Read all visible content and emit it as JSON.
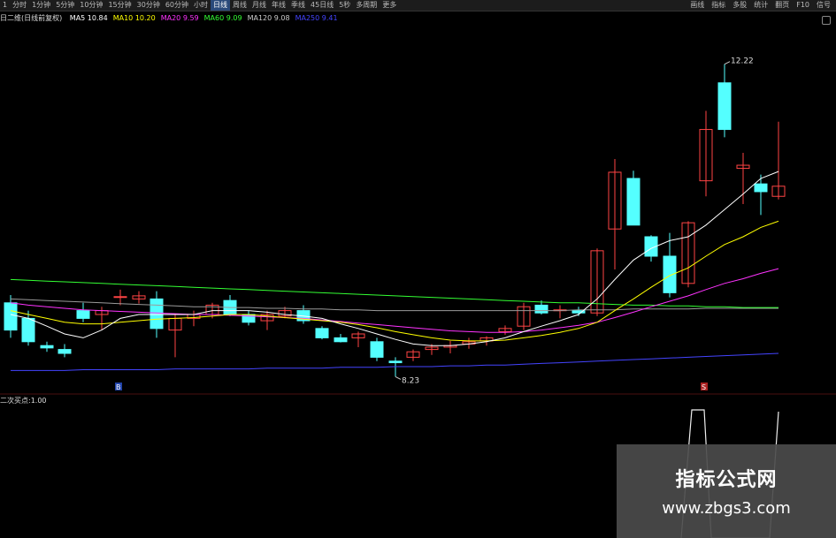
{
  "toolbar": {
    "left_items": [
      "1",
      "分时",
      "1分钟",
      "5分钟",
      "10分钟",
      "15分钟",
      "30分钟",
      "60分钟",
      "小时",
      "日线",
      "周线",
      "月线",
      "年线",
      "季线",
      "45日线",
      "5秒",
      "多周期",
      "更多"
    ],
    "active_index": 9,
    "right_items": [
      "画线",
      "指标",
      "多股",
      "统计",
      "翻页",
      "F10",
      "信号"
    ]
  },
  "legend": {
    "title": "日二维(日线前复权)",
    "items": [
      {
        "label": "MA5",
        "value": "10.84",
        "color": "#ffffff"
      },
      {
        "label": "MA10",
        "value": "10.20",
        "color": "#ffff00"
      },
      {
        "label": "MA20",
        "value": "9.59",
        "color": "#ff33ff"
      },
      {
        "label": "MA60",
        "value": "9.09",
        "color": "#33ff33"
      },
      {
        "label": "MA120",
        "value": "9.08",
        "color": "#cccccc"
      },
      {
        "label": "MA250",
        "value": "9.41",
        "color": "#4444ff"
      }
    ]
  },
  "annotations": {
    "high": "12.22",
    "low": "8.23"
  },
  "signal_labels": [
    "B",
    "S"
  ],
  "sub_indicator": {
    "label": "二次买点",
    "value": "1.00"
  },
  "watermark": {
    "title": "指标公式网",
    "url": "www.zbgs3.com"
  },
  "colors": {
    "up": "#ff4444",
    "down": "#54ffff",
    "background": "#000000"
  }
}
